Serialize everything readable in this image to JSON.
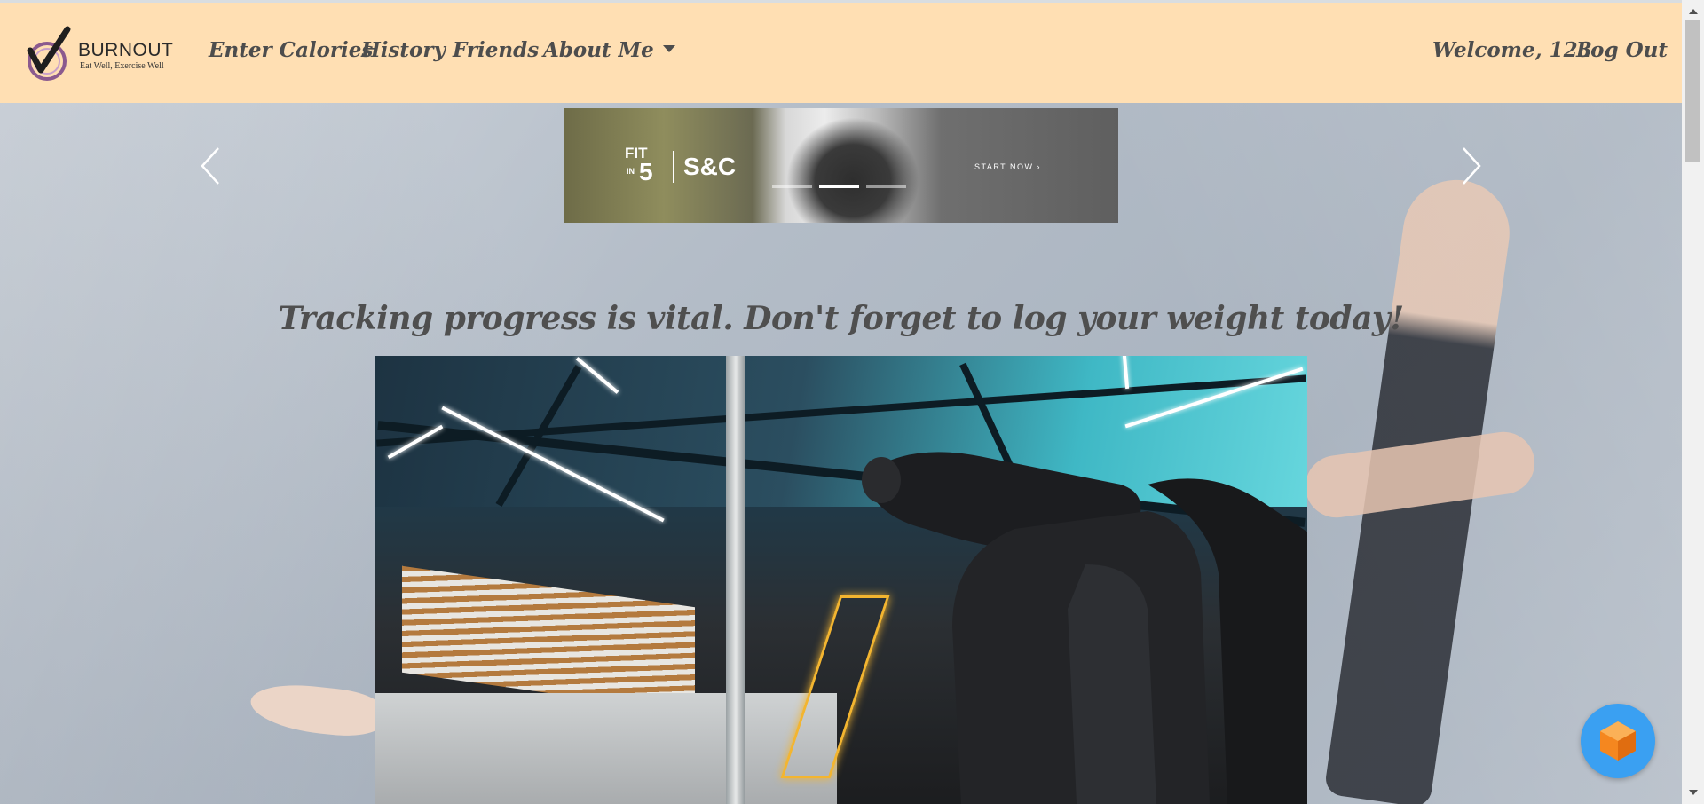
{
  "brand": {
    "name": "BURNOUT",
    "tagline": "Eat Well, Exercise Well"
  },
  "nav": {
    "links": [
      "Enter Calories",
      "History",
      "Friends",
      "About Me"
    ],
    "welcome": "Welcome, 123",
    "logout": "Log Out"
  },
  "banner": {
    "fit": "FIT",
    "in": "IN",
    "five": "5",
    "sc": "S&C",
    "cta": "START NOW ›",
    "active_slide": 2,
    "slide_count": 3
  },
  "main": {
    "headline": "Tracking progress is vital. Don't forget to log your weight today!"
  },
  "colors": {
    "navbar": "#ffdfb3",
    "nav_text": "#4d4d4d",
    "chat_button": "#3aa0f2",
    "chat_cube": "#f5871f"
  },
  "icons": {
    "logo": "burnout-logo-icon",
    "prev": "chevron-left-icon",
    "next": "chevron-right-icon",
    "dropdown": "caret-down-icon",
    "chat": "cube-chat-icon"
  }
}
